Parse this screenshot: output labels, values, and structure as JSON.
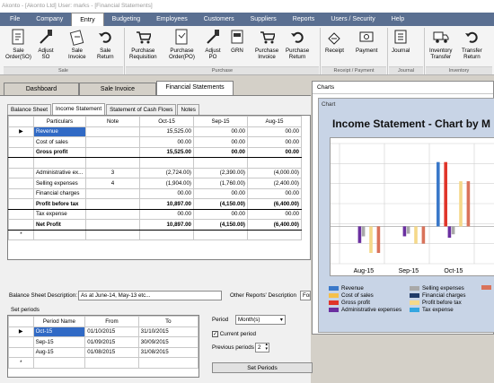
{
  "window": {
    "title": "Akonto - [Akonto Ltd]  User: marks - [Financial Statements]"
  },
  "menu": [
    "File",
    "Company",
    "Entry",
    "Budgeting",
    "Employees",
    "Customers",
    "Suppliers",
    "Reports",
    "Users / Security",
    "Help"
  ],
  "ribbon": {
    "buttons": [
      {
        "label": "Sale\nOrder(SO)",
        "icon": "sale-order-icon"
      },
      {
        "label": "Adjust\nSO",
        "icon": "adjust-icon"
      },
      {
        "label": "Sale\nInvoice",
        "icon": "sale-invoice-icon"
      },
      {
        "label": "Sale\nReturn",
        "icon": "return-icon"
      },
      {
        "label": "Purchase\nRequisition",
        "icon": "cart-icon"
      },
      {
        "label": "Purchase\nOrder(PO)",
        "icon": "document-icon"
      },
      {
        "label": "Adjust\nPO",
        "icon": "adjust-icon"
      },
      {
        "label": "GRN",
        "icon": "grn-icon"
      },
      {
        "label": "Purchase\nInvoice",
        "icon": "cart-icon"
      },
      {
        "label": "Purchase\nReturn",
        "icon": "return-icon"
      },
      {
        "label": "Receipt",
        "icon": "receipt-icon"
      },
      {
        "label": "Payment",
        "icon": "payment-icon"
      },
      {
        "label": "Journal",
        "icon": "journal-icon"
      },
      {
        "label": "Inventory\nTransfer",
        "icon": "truck-icon"
      },
      {
        "label": "Transfer\nReturn",
        "icon": "return-icon"
      }
    ],
    "groups": [
      "Sale",
      "Purchase",
      "Receipt / Payment",
      "Journal",
      "Inventory"
    ]
  },
  "doctabs": [
    "Dashboard",
    "Sale Invoice",
    "Financial Statements"
  ],
  "subtabs": [
    "Balance Sheet",
    "Income Statement",
    "Statement of Cash Flows",
    "Notes"
  ],
  "grid": {
    "headers": [
      "Particulars",
      "Note",
      "Oct-15",
      "Sep-15",
      "Aug-15"
    ],
    "rows": [
      {
        "p": "Revenue",
        "note": "",
        "c1": "15,525.00",
        "c2": "00.00",
        "c3": "00.00",
        "style": "sel"
      },
      {
        "p": "Cost of sales",
        "note": "",
        "c1": "00.00",
        "c2": "00.00",
        "c3": "00.00",
        "style": ""
      },
      {
        "p": "Gross profit",
        "note": "",
        "c1": "15,525.00",
        "c2": "00.00",
        "c3": "00.00",
        "style": "bold"
      },
      {
        "p": "",
        "note": "",
        "c1": "",
        "c2": "",
        "c3": "",
        "style": ""
      },
      {
        "p": "Administrative ex...",
        "note": "3",
        "c1": "(2,724.00)",
        "c2": "(2,390.00)",
        "c3": "(4,000.00)",
        "style": ""
      },
      {
        "p": "Selling expenses",
        "note": "4",
        "c1": "(1,904.00)",
        "c2": "(1,760.00)",
        "c3": "(2,400.00)",
        "style": ""
      },
      {
        "p": "Financial charges",
        "note": "",
        "c1": "00.00",
        "c2": "00.00",
        "c3": "00.00",
        "style": ""
      },
      {
        "p": "Profit before tax",
        "note": "",
        "c1": "10,897.00",
        "c2": "(4,150.00)",
        "c3": "(6,400.00)",
        "style": "bold"
      },
      {
        "p": "Tax expense",
        "note": "",
        "c1": "00.00",
        "c2": "00.00",
        "c3": "00.00",
        "style": ""
      },
      {
        "p": "Net Profit",
        "note": "",
        "c1": "10,897.00",
        "c2": "(4,150.00)",
        "c3": "(6,400.00)",
        "style": "bold"
      },
      {
        "p": "",
        "note": "",
        "c1": "",
        "c2": "",
        "c3": "",
        "style": ""
      }
    ],
    "new_row_marker": "*",
    "current_row_marker": "▶"
  },
  "footer": {
    "bs_desc_label": "Balance Sheet Description:",
    "bs_desc_value": "As at June-14, May-13 etc...",
    "other_desc_label": "Other Reports' Description",
    "other_desc_value": "For t",
    "set_periods_label": "Set periods",
    "period_label": "Period",
    "period_value": "Month(s)",
    "current_period_label": "Current period",
    "current_period_checked": true,
    "previous_periods_label": "Previous periods",
    "previous_periods_value": "2",
    "set_periods_button": "Set Periods"
  },
  "periods": {
    "headers": [
      "Period Name",
      "From",
      "To"
    ],
    "rows": [
      [
        "Oct-15",
        "01/10/2015",
        "31/10/2015"
      ],
      [
        "Sep-15",
        "01/09/2015",
        "30/09/2015"
      ],
      [
        "Aug-15",
        "01/08/2015",
        "31/08/2015"
      ]
    ]
  },
  "chart_window": {
    "title": "Charts",
    "inner_label": "Chart"
  },
  "chart_data": {
    "type": "bar",
    "title": "Income Statement - Chart by M",
    "categories": [
      "Aug-15",
      "Sep-15",
      "Oct-15"
    ],
    "series": [
      {
        "name": "Revenue",
        "color": "#3a78c9",
        "values": [
          0,
          0,
          15525
        ]
      },
      {
        "name": "Cost of sales",
        "color": "#f5c04a",
        "values": [
          0,
          0,
          0
        ]
      },
      {
        "name": "Gross profit",
        "color": "#e0352a",
        "values": [
          0,
          0,
          15525
        ]
      },
      {
        "name": "Administrative expenses",
        "color": "#6a2fa0",
        "values": [
          -4000,
          -2390,
          -2724
        ]
      },
      {
        "name": "Selling expenses",
        "color": "#a9a9a9",
        "values": [
          -2400,
          -1760,
          -1904
        ]
      },
      {
        "name": "Financial charges",
        "color": "#1f3a68",
        "values": [
          0,
          0,
          0
        ]
      },
      {
        "name": "Profit before tax",
        "color": "#f5d98a",
        "values": [
          -6400,
          -4150,
          10897
        ]
      },
      {
        "name": "Tax expense",
        "color": "#34a6e0",
        "values": [
          0,
          0,
          0
        ]
      },
      {
        "name": "",
        "color": "#d9735a",
        "values": [
          -6400,
          -4150,
          10897
        ]
      }
    ],
    "ylim": [
      -9000,
      20000
    ]
  }
}
